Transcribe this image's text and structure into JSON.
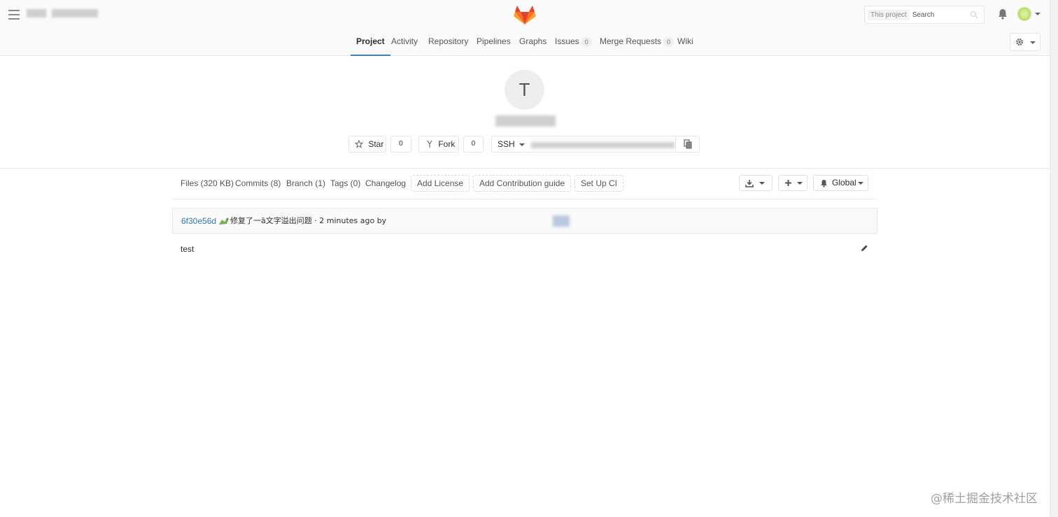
{
  "header": {
    "search_scope": "This project",
    "search_placeholder": "Search"
  },
  "nav": {
    "items": [
      {
        "label": "Project"
      },
      {
        "label": "Activity"
      },
      {
        "label": "Repository"
      },
      {
        "label": "Pipelines"
      },
      {
        "label": "Graphs"
      },
      {
        "label": "Issues",
        "badge": "0"
      },
      {
        "label": "Merge Requests",
        "badge": "0"
      },
      {
        "label": "Wiki"
      }
    ]
  },
  "project": {
    "avatar_letter": "T",
    "star_label": "Star",
    "star_count": "0",
    "fork_label": "Fork",
    "fork_count": "0",
    "protocol": "SSH"
  },
  "subnav": {
    "files": "Files (320 KB)",
    "commits": "Commits (8)",
    "branch": "Branch (1)",
    "tags": "Tags (0)",
    "changelog": "Changelog",
    "add_license": "Add License",
    "add_contribution": "Add Contribution guide",
    "setup_ci": "Set Up CI",
    "notification_level": "Global"
  },
  "commit": {
    "sha": "6f30e56d",
    "message": "修复了一ā文字溢出问题 · 2 minutes ago by"
  },
  "readme": {
    "text": "test"
  },
  "watermark": "@稀土掘金技术社区",
  "colors": {
    "accent": "#3e82c5",
    "link": "#3777b0",
    "border": "#e5e5e5",
    "logo_orange": "#e24329",
    "logo_light": "#fca326"
  }
}
